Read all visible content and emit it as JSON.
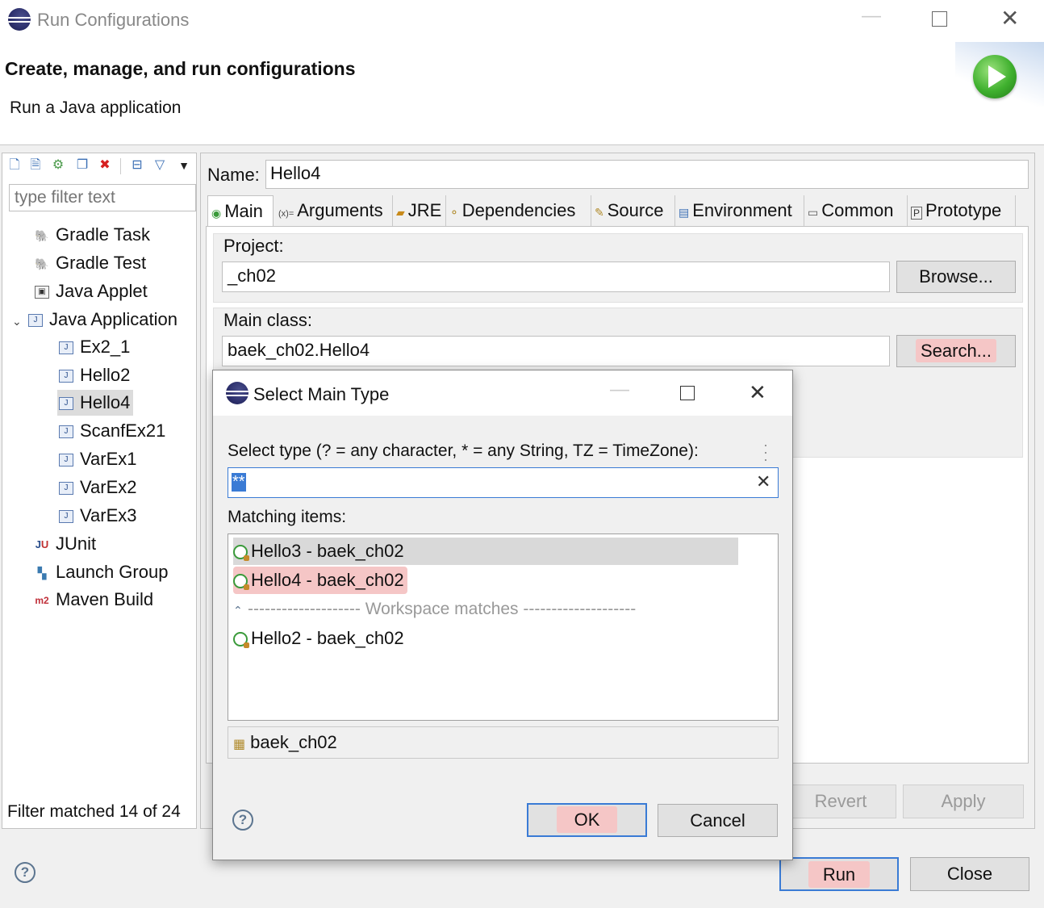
{
  "window": {
    "title": "Run Configurations",
    "minimize_icon": "minimize-icon",
    "maximize_icon": "maximize-icon",
    "close_icon": "close-icon"
  },
  "header": {
    "title": "Create, manage, and run configurations",
    "subtitle": "Run a Java application",
    "logo": "run-logo-icon"
  },
  "left_panel": {
    "toolbar": [
      "new-config-icon",
      "new-prototype-icon",
      "duplicate-icon",
      "copy-icon",
      "delete-icon",
      "collapse-all-icon",
      "filter-icon",
      "menu-dropdown-icon"
    ],
    "filter_placeholder": "type filter text",
    "tree": [
      {
        "label": "Gradle Task",
        "icon": "gradle-icon",
        "level": 0
      },
      {
        "label": "Gradle Test",
        "icon": "gradle-icon",
        "level": 0
      },
      {
        "label": "Java Applet",
        "icon": "applet-icon",
        "level": 0
      },
      {
        "label": "Java Application",
        "icon": "java-app-icon",
        "level": 0,
        "expanded": true
      },
      {
        "label": "Ex2_1",
        "icon": "java-app-icon",
        "level": 1
      },
      {
        "label": "Hello2",
        "icon": "java-app-icon",
        "level": 1
      },
      {
        "label": "Hello4",
        "icon": "java-app-icon",
        "level": 1,
        "selected": true
      },
      {
        "label": "ScanfEx21",
        "icon": "java-app-icon",
        "level": 1
      },
      {
        "label": "VarEx1",
        "icon": "java-app-icon",
        "level": 1
      },
      {
        "label": "VarEx2",
        "icon": "java-app-icon",
        "level": 1
      },
      {
        "label": "VarEx3",
        "icon": "java-app-icon",
        "level": 1
      },
      {
        "label": "JUnit",
        "icon": "junit-icon",
        "level": 0
      },
      {
        "label": "Launch Group",
        "icon": "launch-group-icon",
        "level": 0
      },
      {
        "label": "Maven Build",
        "icon": "maven-icon",
        "level": 0
      }
    ],
    "status": "Filter matched 14 of 24"
  },
  "right_panel": {
    "name_label": "Name:",
    "name_value": "Hello4",
    "tabs": [
      {
        "label": "Main",
        "icon": "main-tab-icon",
        "active": true
      },
      {
        "label": "Arguments",
        "icon": "arguments-icon"
      },
      {
        "label": "JRE",
        "icon": "jre-icon"
      },
      {
        "label": "Dependencies",
        "icon": "dependencies-icon"
      },
      {
        "label": "Source",
        "icon": "source-icon"
      },
      {
        "label": "Environment",
        "icon": "environment-icon"
      },
      {
        "label": "Common",
        "icon": "common-icon"
      },
      {
        "label": "Prototype",
        "icon": "prototype-icon"
      }
    ],
    "project_label": "Project:",
    "project_value": "_ch02",
    "browse_label": "Browse...",
    "main_class_label": "Main class:",
    "main_class_value": "baek_ch02.Hello4",
    "search_label": "Search...",
    "revert_label": "Revert",
    "apply_label": "Apply"
  },
  "bottom": {
    "run_label": "Run",
    "close_label": "Close"
  },
  "dialog": {
    "title": "Select Main Type",
    "prompt": "Select type (? = any character, * = any String, TZ = TimeZone):",
    "filter_value": "**",
    "matching_label": "Matching items:",
    "items": [
      {
        "label": "Hello3 - baek_ch02",
        "state": "hover"
      },
      {
        "label": "Hello4 - baek_ch02",
        "state": "selected"
      }
    ],
    "separator": "-------------------- Workspace matches --------------------",
    "workspace_items": [
      {
        "label": "Hello2 - baek_ch02"
      }
    ],
    "package": "baek_ch02",
    "ok_label": "OK",
    "cancel_label": "Cancel"
  }
}
